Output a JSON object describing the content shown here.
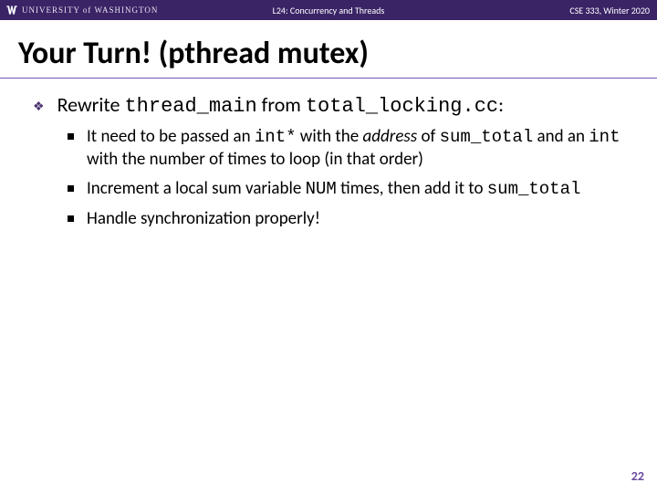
{
  "header": {
    "university": "UNIVERSITY of WASHINGTON",
    "lecture": "L24:  Concurrency and Threads",
    "course": "CSE 333, Winter 2020"
  },
  "title": "Your Turn!  (pthread mutex)",
  "bullets": {
    "b1": {
      "pre": "Rewrite ",
      "code1": "thread_main",
      "mid": " from ",
      "code2": "total_locking.cc",
      "post": ":"
    },
    "sub": [
      {
        "t1": "It need to be passed an ",
        "c1": "int*",
        "t2": " with the ",
        "i1": "address",
        "t3": " of ",
        "c2": "sum_total",
        "t4": " and an ",
        "c3": "int",
        "t5": " with the number of times to loop (in that order)"
      },
      {
        "t1": "Increment a local sum variable ",
        "c1": "NUM",
        "t2": " times, then add it to ",
        "c2": "sum_total",
        "t3": "",
        "i1": "",
        "t4": "",
        "c3": "",
        "t5": ""
      },
      {
        "t1": "Handle synchronization properly!",
        "c1": "",
        "t2": "",
        "i1": "",
        "t3": "",
        "c2": "",
        "t4": "",
        "c3": "",
        "t5": ""
      }
    ]
  },
  "pagenum": "22"
}
